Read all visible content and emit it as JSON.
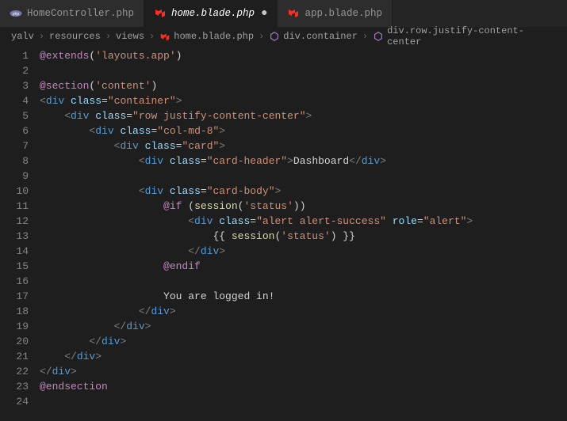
{
  "tabs": [
    {
      "label": "HomeController.php",
      "icon": "php",
      "active": false
    },
    {
      "label": "home.blade.php",
      "icon": "laravel",
      "active": true,
      "modified": true
    },
    {
      "label": "app.blade.php",
      "icon": "laravel",
      "active": false
    }
  ],
  "breadcrumbs": [
    {
      "label": "yalv",
      "type": "folder"
    },
    {
      "label": "resources",
      "type": "folder"
    },
    {
      "label": "views",
      "type": "folder"
    },
    {
      "label": "home.blade.php",
      "type": "file",
      "icon": "laravel"
    },
    {
      "label": "div.container",
      "type": "symbol"
    },
    {
      "label": "div.row.justify-content-center",
      "type": "symbol"
    }
  ],
  "code_tokens": [
    [
      [
        "kw",
        "@extends"
      ],
      [
        "pn",
        "("
      ],
      [
        "str",
        "'layouts.app'"
      ],
      [
        "pn",
        ")"
      ]
    ],
    [],
    [
      [
        "kw",
        "@section"
      ],
      [
        "pn",
        "("
      ],
      [
        "str",
        "'content'"
      ],
      [
        "pn",
        ")"
      ]
    ],
    [
      [
        "punc",
        "<"
      ],
      [
        "tag",
        "div "
      ],
      [
        "attr",
        "class"
      ],
      [
        "pn",
        "="
      ],
      [
        "str",
        "\"container\""
      ],
      [
        "punc",
        ">"
      ]
    ],
    [
      [
        "txt",
        "    "
      ],
      [
        "punc",
        "<"
      ],
      [
        "tag",
        "div "
      ],
      [
        "attr",
        "class"
      ],
      [
        "pn",
        "="
      ],
      [
        "str",
        "\"row justify-content-center\""
      ],
      [
        "punc",
        ">"
      ]
    ],
    [
      [
        "txt",
        "        "
      ],
      [
        "punc",
        "<"
      ],
      [
        "tag",
        "div "
      ],
      [
        "attr",
        "class"
      ],
      [
        "pn",
        "="
      ],
      [
        "str",
        "\"col-md-8\""
      ],
      [
        "punc",
        ">"
      ]
    ],
    [
      [
        "txt",
        "            "
      ],
      [
        "punc",
        "<"
      ],
      [
        "tag",
        "div "
      ],
      [
        "attr",
        "class"
      ],
      [
        "pn",
        "="
      ],
      [
        "str",
        "\"card\""
      ],
      [
        "punc",
        ">"
      ]
    ],
    [
      [
        "txt",
        "                "
      ],
      [
        "punc",
        "<"
      ],
      [
        "tag",
        "div "
      ],
      [
        "attr",
        "class"
      ],
      [
        "pn",
        "="
      ],
      [
        "str",
        "\"card-header\""
      ],
      [
        "punc",
        ">"
      ],
      [
        "txt",
        "Dashboard"
      ],
      [
        "punc",
        "</"
      ],
      [
        "tag",
        "div"
      ],
      [
        "punc",
        ">"
      ]
    ],
    [],
    [
      [
        "txt",
        "                "
      ],
      [
        "punc",
        "<"
      ],
      [
        "tag",
        "div "
      ],
      [
        "attr",
        "class"
      ],
      [
        "pn",
        "="
      ],
      [
        "str",
        "\"card-body\""
      ],
      [
        "punc",
        ">"
      ]
    ],
    [
      [
        "txt",
        "                    "
      ],
      [
        "kw",
        "@if "
      ],
      [
        "pn",
        "("
      ],
      [
        "fn",
        "session"
      ],
      [
        "pn",
        "("
      ],
      [
        "str",
        "'status'"
      ],
      [
        "pn",
        "))"
      ]
    ],
    [
      [
        "txt",
        "                        "
      ],
      [
        "punc",
        "<"
      ],
      [
        "tag",
        "div "
      ],
      [
        "attr",
        "class"
      ],
      [
        "pn",
        "="
      ],
      [
        "str",
        "\"alert alert-success\""
      ],
      [
        "tag",
        " "
      ],
      [
        "attr",
        "role"
      ],
      [
        "pn",
        "="
      ],
      [
        "str",
        "\"alert\""
      ],
      [
        "punc",
        ">"
      ]
    ],
    [
      [
        "txt",
        "                            "
      ],
      [
        "pn",
        "{{ "
      ],
      [
        "fn",
        "session"
      ],
      [
        "pn",
        "("
      ],
      [
        "str",
        "'status'"
      ],
      [
        "pn",
        ") }}"
      ]
    ],
    [
      [
        "txt",
        "                        "
      ],
      [
        "punc",
        "</"
      ],
      [
        "tag",
        "div"
      ],
      [
        "punc",
        ">"
      ]
    ],
    [
      [
        "txt",
        "                    "
      ],
      [
        "kw",
        "@endif"
      ]
    ],
    [],
    [
      [
        "txt",
        "                    You are logged in!"
      ]
    ],
    [
      [
        "txt",
        "                "
      ],
      [
        "punc",
        "</"
      ],
      [
        "tag",
        "div"
      ],
      [
        "punc",
        ">"
      ]
    ],
    [
      [
        "txt",
        "            "
      ],
      [
        "punc",
        "</"
      ],
      [
        "tag",
        "div"
      ],
      [
        "punc",
        ">"
      ]
    ],
    [
      [
        "txt",
        "        "
      ],
      [
        "punc",
        "</"
      ],
      [
        "tag",
        "div"
      ],
      [
        "punc",
        ">"
      ]
    ],
    [
      [
        "txt",
        "    "
      ],
      [
        "punc",
        "</"
      ],
      [
        "tag",
        "div"
      ],
      [
        "punc",
        ">"
      ]
    ],
    [
      [
        "punc",
        "</"
      ],
      [
        "tag",
        "div"
      ],
      [
        "punc",
        ">"
      ]
    ],
    [
      [
        "kw",
        "@endsection"
      ]
    ],
    []
  ],
  "line_count": 24
}
